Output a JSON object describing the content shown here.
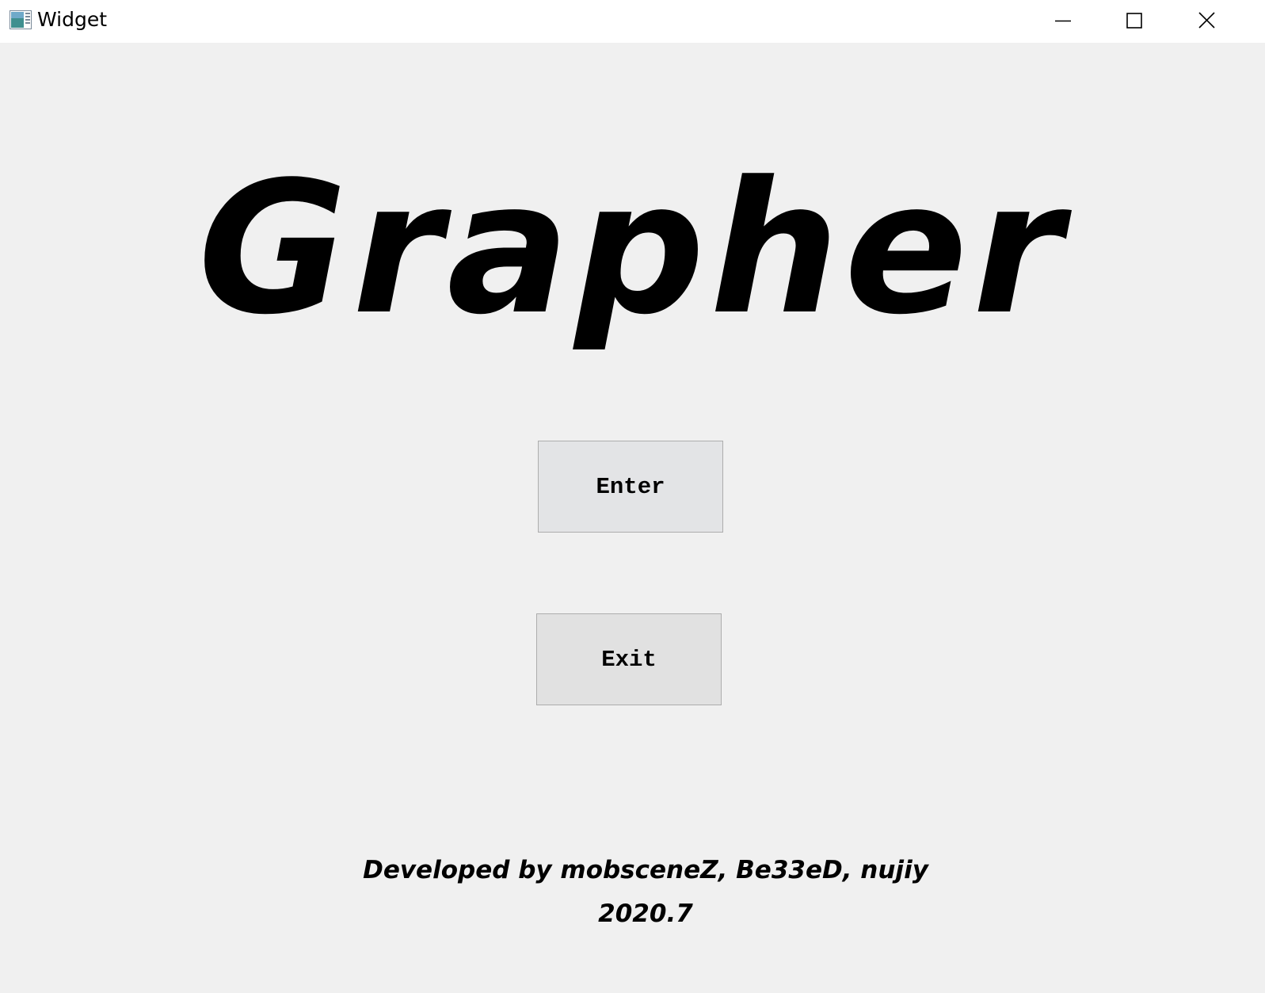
{
  "window": {
    "title": "Widget",
    "icon": "app-window-icon",
    "controls": {
      "minimize_icon": "minimize-icon",
      "maximize_icon": "maximize-icon",
      "close_icon": "close-icon"
    }
  },
  "main": {
    "heading": "Grapher",
    "buttons": {
      "enter_label": "Enter",
      "exit_label": "Exit"
    },
    "credits": {
      "developers": "Developed by mobsceneZ, Be33eD, nujiy",
      "date": "2020.7"
    }
  },
  "colors": {
    "background": "#f0f0f0",
    "titlebar": "#ffffff",
    "button_face": "#e1e1e1",
    "button_border": "#adadad"
  }
}
